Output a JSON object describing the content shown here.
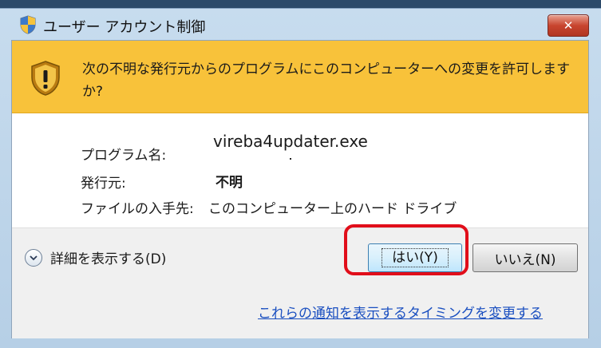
{
  "window": {
    "title": "ユーザー アカウント制御",
    "close_label": "✕"
  },
  "banner": {
    "message": "次の不明な発行元からのプログラムにこのコンピューターへの変更を許可しますか?"
  },
  "info": {
    "program_label": "プログラム名:",
    "program_value": "vireba4updater.exe",
    "publisher_label": "発行元:",
    "publisher_value": "不明",
    "origin_label": "ファイルの入手先:",
    "origin_value": "このコンピューター上のハード ドライブ"
  },
  "footer": {
    "details_label": "詳細を表示する(D)",
    "yes_label": "はい(Y)",
    "no_label": "いいえ(N)",
    "notify_link": "これらの通知を表示するタイミングを変更する"
  },
  "colors": {
    "banner": "#f8c23a",
    "highlight": "#e10e1a",
    "link": "#1a4fc0"
  },
  "icons": [
    "uac-shield-icon",
    "warning-shield-icon",
    "close-icon",
    "chevron-down-icon"
  ]
}
